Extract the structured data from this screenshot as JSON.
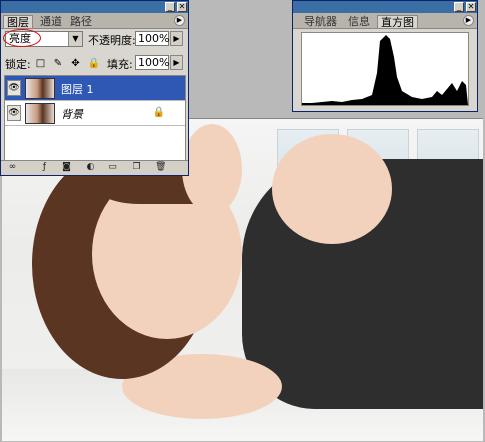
{
  "layers_panel": {
    "tabs": [
      "图层",
      "通道",
      "路径"
    ],
    "blend_mode": "亮度",
    "opacity_label": "不透明度:",
    "opacity_value": "100%",
    "lock_label": "锁定:",
    "fill_label": "填充:",
    "fill_value": "100%",
    "layers": [
      {
        "name": "图层 1",
        "selected": true
      },
      {
        "name": "背景",
        "selected": false,
        "locked": true
      }
    ]
  },
  "histogram_panel": {
    "tabs": [
      "导航器",
      "信息",
      "直方图"
    ],
    "active_tab": "直方图"
  },
  "icons": {
    "minimize": "minimize-icon",
    "close": "close-icon",
    "panel_menu": "panel-menu-icon",
    "visibility": "eye-icon",
    "lock": "lock-icon"
  },
  "colors": {
    "title_bar": "#3a6ea5",
    "selected_layer": "#2f57b4",
    "highlight_ring": "#d01010",
    "panel_bg": "#d9d6cf"
  }
}
